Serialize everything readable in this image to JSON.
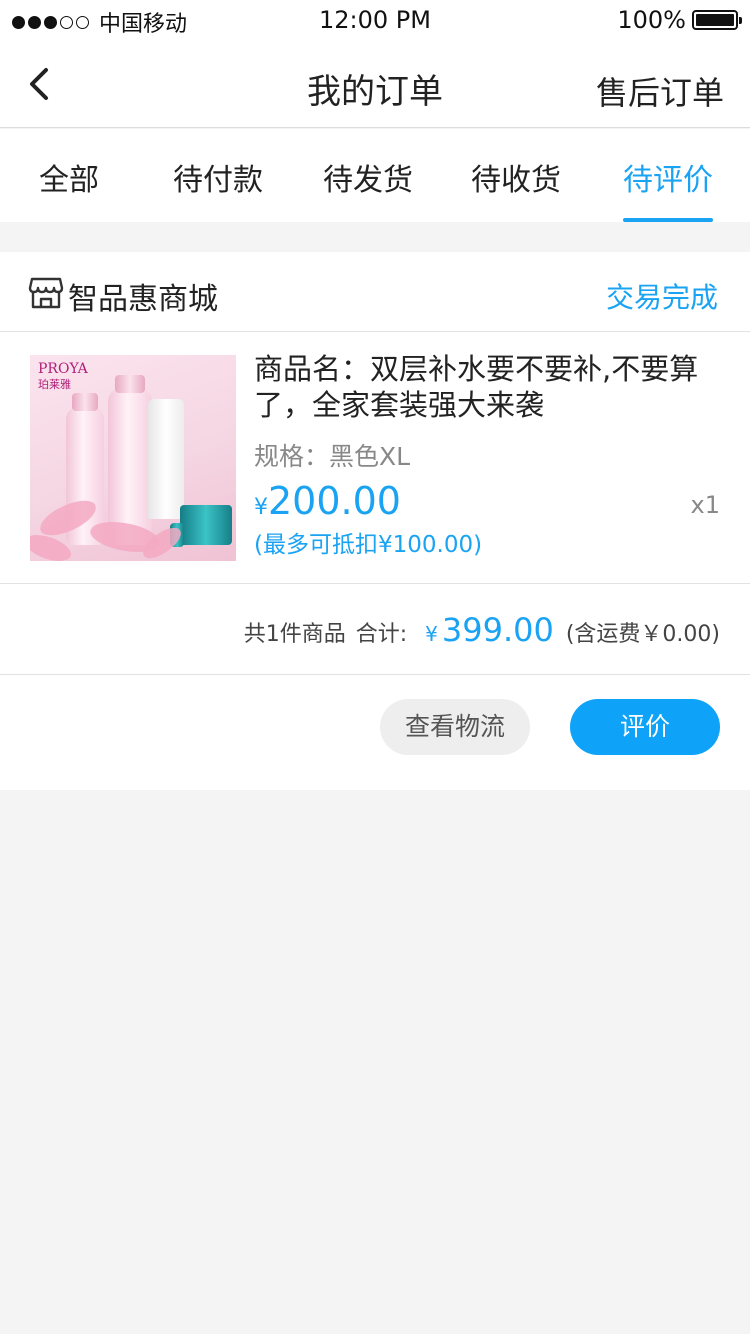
{
  "status_bar": {
    "carrier": "中国移动",
    "time": "12:00 PM",
    "battery": "100%"
  },
  "nav": {
    "title": "我的订单",
    "right_label": "售后订单",
    "back_icon": "chevron-left-icon"
  },
  "tabs": [
    {
      "label": "全部",
      "active": false
    },
    {
      "label": "待付款",
      "active": false
    },
    {
      "label": "待发货",
      "active": false
    },
    {
      "label": "待收货",
      "active": false
    },
    {
      "label": "待评价",
      "active": true
    }
  ],
  "order": {
    "shop_icon": "store-icon",
    "shop_name": "智品惠商城",
    "status": "交易完成",
    "item": {
      "image_brand": "PROYA",
      "image_brand_cn": "珀莱雅",
      "name": "商品名：双层补水要不要补,不要算了，全家套装强大来袭",
      "spec": "规格：黑色XL",
      "price_symbol": "¥",
      "price": "200.00",
      "deduct": "(最多可抵扣¥100.00)",
      "qty": "x1"
    },
    "summary": {
      "count_text": "共1件商品",
      "total_label": "合计:",
      "total_symbol": "¥",
      "total": "399.00",
      "shipping": "(含运费￥0.00)"
    },
    "buttons": {
      "logistics": "查看物流",
      "review": "评价"
    }
  },
  "colors": {
    "accent": "#1aa3f3",
    "button_primary": "#0ea3f8",
    "page_bg": "#f4f4f4"
  }
}
